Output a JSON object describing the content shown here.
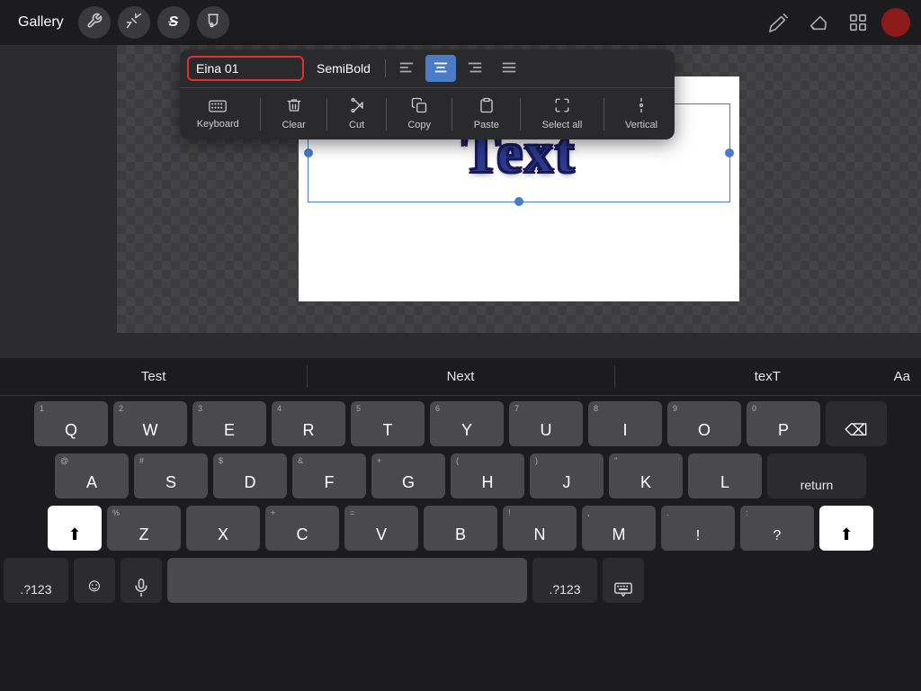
{
  "topToolbar": {
    "gallery_label": "Gallery",
    "icon_wrench": "⚙",
    "icon_magic": "✦",
    "icon_s": "S",
    "icon_brush": "✏"
  },
  "floatingToolbar": {
    "font_name": "Eina 01",
    "font_weight": "SemiBold",
    "align_left": "≡",
    "align_center": "≡",
    "align_right": "≡",
    "align_justify": "≡",
    "actions": [
      {
        "id": "keyboard",
        "icon": "⌨",
        "label": "Keyboard"
      },
      {
        "id": "clear",
        "icon": "✂",
        "label": "Clear"
      },
      {
        "id": "cut",
        "icon": "✂",
        "label": "Cut"
      },
      {
        "id": "copy",
        "icon": "⊕",
        "label": "Copy"
      },
      {
        "id": "paste",
        "icon": "⊖",
        "label": "Paste"
      },
      {
        "id": "select_all",
        "icon": "⟺",
        "label": "Select all"
      },
      {
        "id": "vertical",
        "icon": "⊕",
        "label": "Vertical"
      }
    ]
  },
  "canvas": {
    "main_text": "Text"
  },
  "keyboard": {
    "predictive": [
      "Test",
      "Next",
      "texT"
    ],
    "aa_label": "Aa",
    "rows": [
      [
        {
          "key": "Q",
          "num": "1"
        },
        {
          "key": "W",
          "num": "2"
        },
        {
          "key": "E",
          "num": "3"
        },
        {
          "key": "R",
          "num": "4"
        },
        {
          "key": "T",
          "num": "5"
        },
        {
          "key": "Y",
          "num": "6"
        },
        {
          "key": "U",
          "num": "7"
        },
        {
          "key": "I",
          "num": "8"
        },
        {
          "key": "O",
          "num": "9"
        },
        {
          "key": "P",
          "num": "0"
        }
      ],
      [
        {
          "key": "A",
          "sym": "@"
        },
        {
          "key": "S",
          "sym": "#"
        },
        {
          "key": "D",
          "sym": "$"
        },
        {
          "key": "F",
          "sym": "&"
        },
        {
          "key": "G",
          "sym": "+"
        },
        {
          "key": "H",
          "sym": "("
        },
        {
          "key": "J",
          "sym": ")"
        },
        {
          "key": "K",
          "sym": "\""
        },
        {
          "key": "L",
          "sym": ""
        }
      ],
      [
        {
          "key": "Z",
          "sym": "%"
        },
        {
          "key": "X",
          "sym": ""
        },
        {
          "key": "C",
          "sym": "+"
        },
        {
          "key": "V",
          "sym": "="
        },
        {
          "key": "B",
          "sym": ""
        },
        {
          "key": "N",
          "sym": "!"
        },
        {
          "key": "M",
          "sym": ","
        },
        {
          "key": ".",
          "sym": ""
        }
      ]
    ],
    "shift_icon": "⬆",
    "delete_icon": "⌫",
    "return_label": "return",
    "numbers_label": ".?123",
    "emoji_icon": "☺",
    "mic_icon": "🎙",
    "space_label": "",
    "numbers_label2": ".?123",
    "keyboard_icon": "⌨"
  }
}
